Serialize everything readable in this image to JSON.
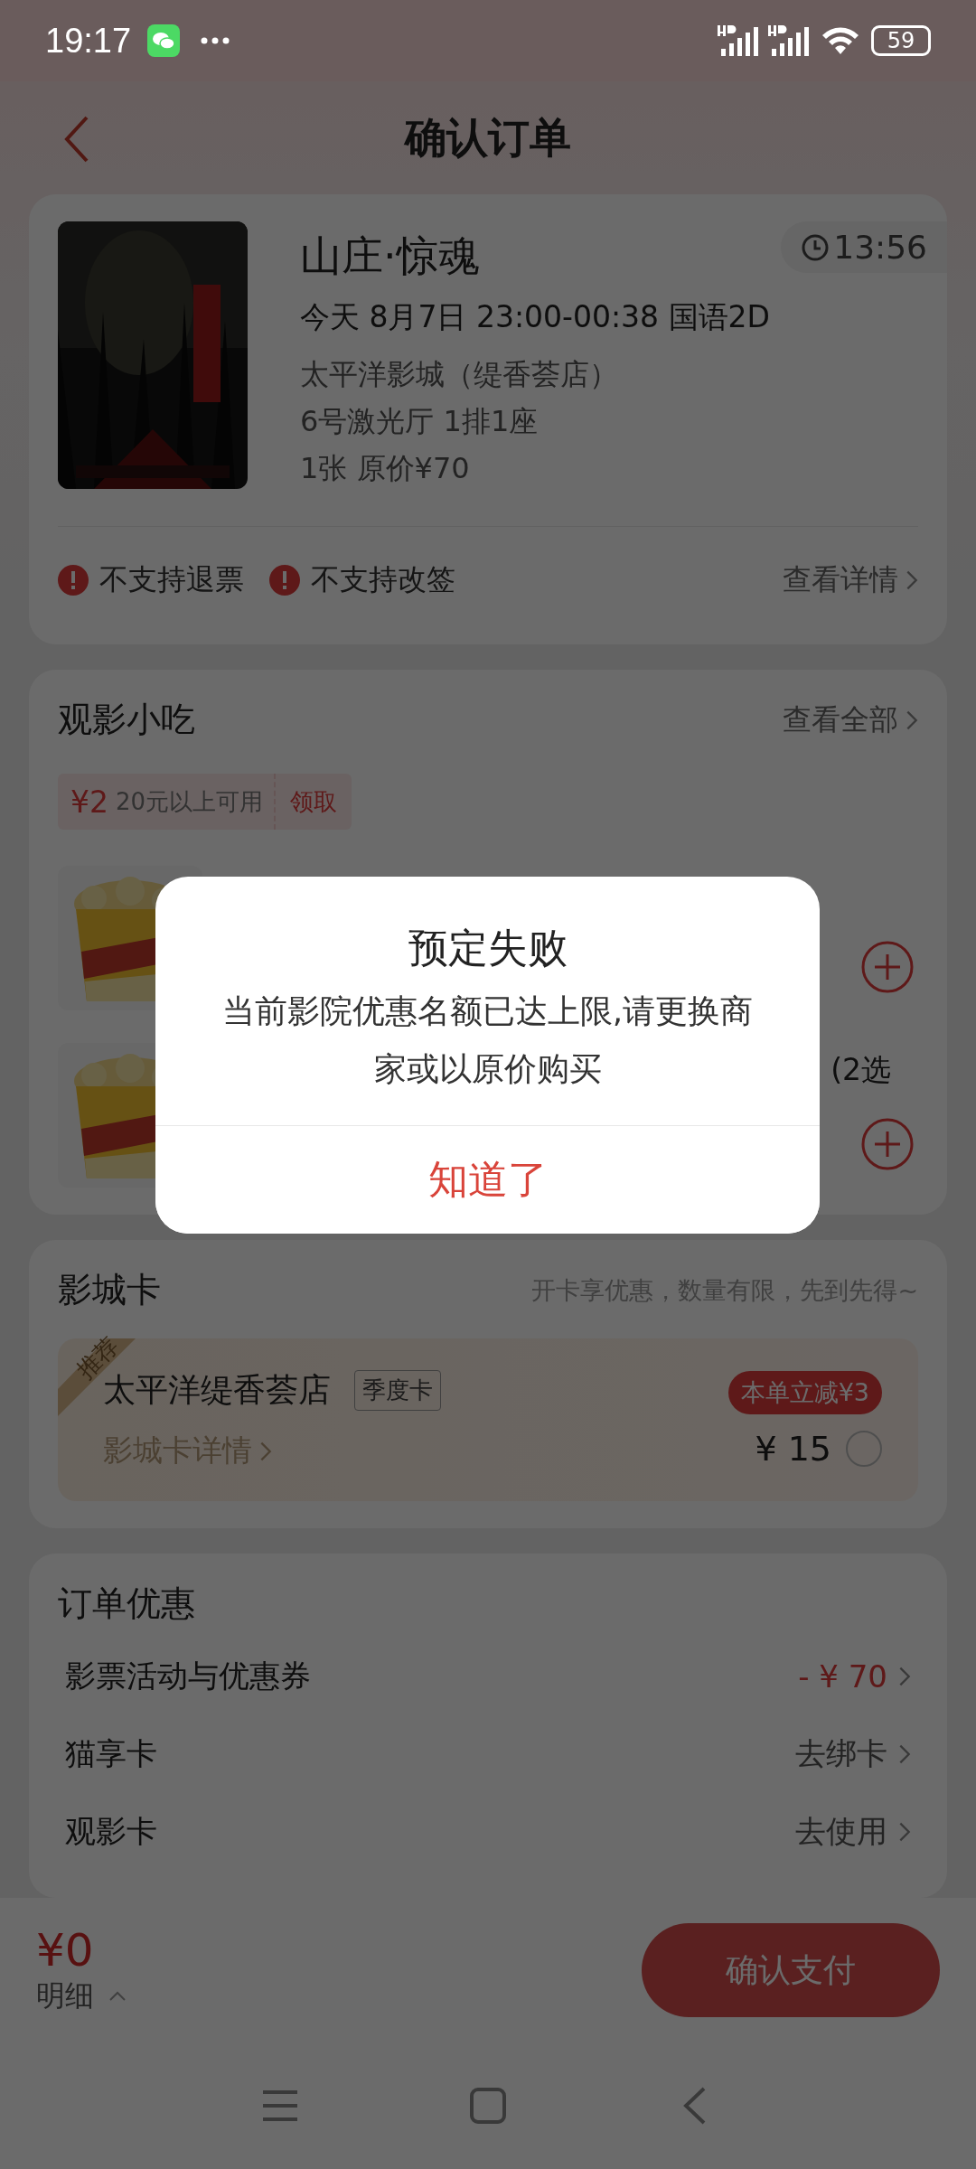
{
  "status_bar": {
    "time": "19:17",
    "battery": "59"
  },
  "header": {
    "title": "确认订单"
  },
  "movie": {
    "poster": {
      "kind": "picture"
    },
    "title": "山庄·惊魂",
    "countdown": "13:56",
    "showtime": "今天 8月7日 23:00-00:38 国语2D",
    "cinema": "太平洋影城（缇香荟店）",
    "hall": "6号激光厅 1排1座",
    "tickets": "1张 原价¥70",
    "notices": [
      "不支持退票",
      "不支持改签"
    ],
    "details_link": "查看详情"
  },
  "snacks": {
    "title": "观影小吃",
    "view_all": "查看全部",
    "coupon": {
      "amount": "¥2",
      "condition": "20元以上可用",
      "action": "领取"
    },
    "items": [
      {
        "image": {
          "kind": "picture"
        }
      },
      {
        "image": {
          "kind": "picture"
        },
        "name": "(2选"
      }
    ]
  },
  "cinema_card": {
    "title": "影城卡",
    "promo": "开卡享优惠，数量有限，先到先得~",
    "card": {
      "ribbon": "推荐",
      "name": "太平洋缇香荟店",
      "type": "季度卡",
      "details": "影城卡详情",
      "discount": "本单立减¥3",
      "price": "¥ 15",
      "selected": false
    }
  },
  "discounts": {
    "title": "订单优惠",
    "rows": [
      {
        "label": "影票活动与优惠券",
        "value": "- ¥ 70",
        "kind": "amount"
      },
      {
        "label": "猫享卡",
        "value": "去绑卡",
        "kind": "link"
      },
      {
        "label": "观影卡",
        "value": "去使用",
        "kind": "link"
      }
    ]
  },
  "footer": {
    "total": "¥0",
    "details": "明细",
    "pay": "确认支付"
  },
  "dialog": {
    "title": "预定失败",
    "message": "当前影院优惠名额已达上限,请更换商家或以原价购买",
    "button": "知道了"
  }
}
